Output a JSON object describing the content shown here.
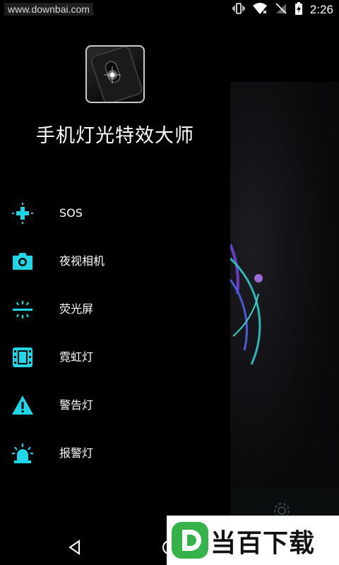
{
  "status_bar": {
    "watermark": "www.downbai.com",
    "time": "2:26"
  },
  "drawer": {
    "app_title": "手机灯光特效大师",
    "menu": [
      {
        "label": "SOS",
        "icon": "sos-cross-icon"
      },
      {
        "label": "夜视相机",
        "icon": "camera-icon"
      },
      {
        "label": "荧光屏",
        "icon": "screen-light-icon"
      },
      {
        "label": "霓虹灯",
        "icon": "film-icon"
      },
      {
        "label": "警告灯",
        "icon": "warning-icon"
      },
      {
        "label": "报警灯",
        "icon": "alarm-light-icon"
      }
    ]
  },
  "ad_watermark": {
    "text": "当百下载"
  },
  "colors": {
    "accent": "#21d4e6",
    "background": "#000000",
    "text": "#ffffff"
  }
}
